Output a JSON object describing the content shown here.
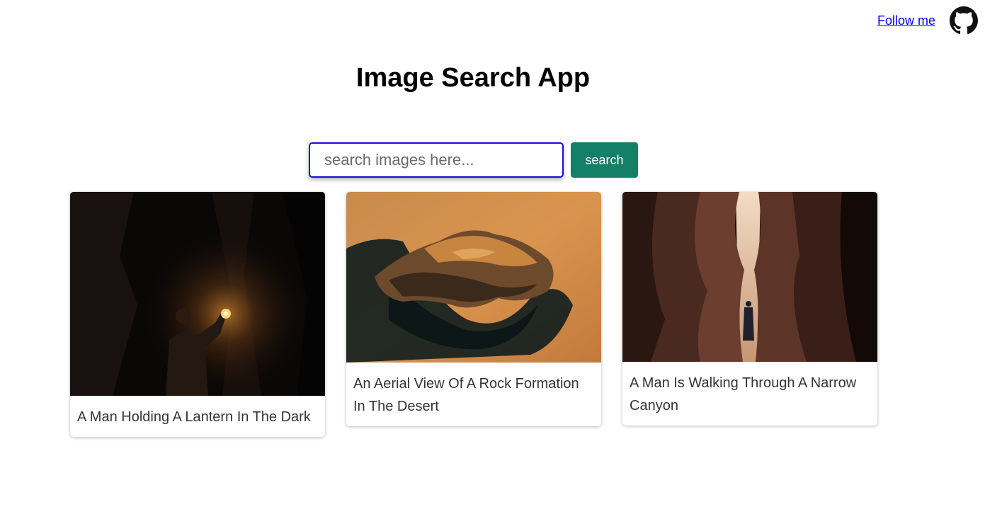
{
  "header": {
    "follow_label": "Follow me",
    "github_icon": "github-icon"
  },
  "page": {
    "title": "Image Search App"
  },
  "search": {
    "placeholder": "search images here...",
    "value": "",
    "button_label": "search"
  },
  "results": [
    {
      "caption": "A Man Holding A Lantern In The Dark",
      "image": "man-with-lantern-in-dark-canyon"
    },
    {
      "caption": "An Aerial View Of A Rock Formation In The Desert",
      "image": "aerial-rock-formation-desert"
    },
    {
      "caption": "A Man Is Walking Through A Narrow Canyon",
      "image": "man-walking-narrow-canyon"
    }
  ],
  "colors": {
    "link": "#0000ee",
    "search_border": "#1a0dd6",
    "button_bg": "#138067",
    "title": "#000000",
    "caption": "#333333"
  }
}
